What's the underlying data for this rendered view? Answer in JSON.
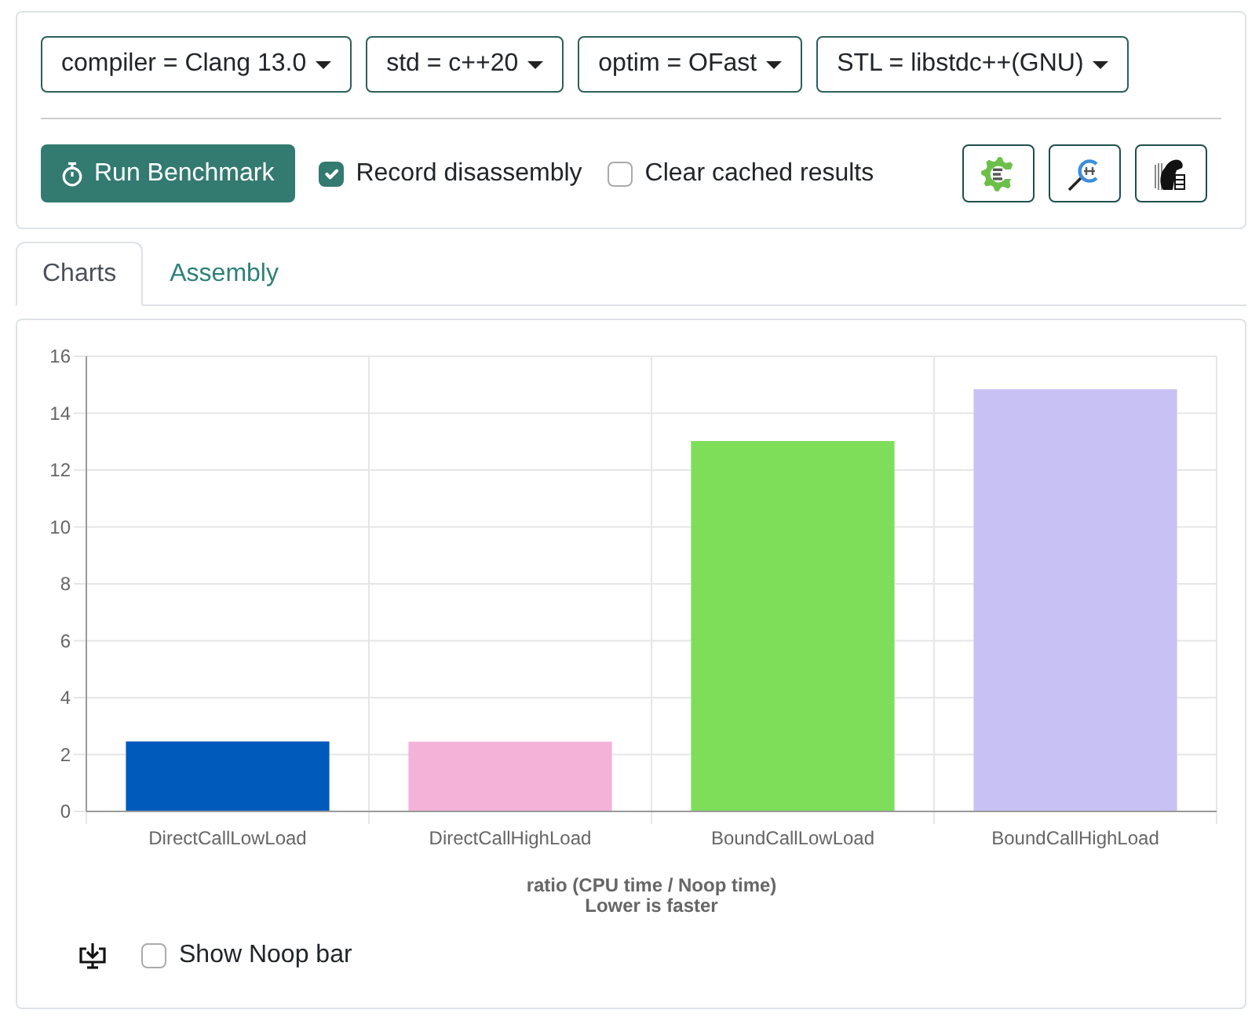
{
  "toolbar": {
    "dropdowns": [
      {
        "label": "compiler = Clang 13.0"
      },
      {
        "label": "std = c++20"
      },
      {
        "label": "optim = OFast"
      },
      {
        "label": "STL = libstdc++(GNU)"
      }
    ],
    "run_button": {
      "label": "Run Benchmark"
    },
    "options": [
      {
        "label": "Record disassembly",
        "checked": true
      },
      {
        "label": "Clear cached results",
        "checked": false
      }
    ]
  },
  "tabs": [
    {
      "label": "Charts",
      "selected": true
    },
    {
      "label": "Assembly",
      "selected": false
    }
  ],
  "chart": {
    "chart_data": {
      "type": "bar",
      "categories": [
        "DirectCallLowLoad",
        "DirectCallHighLoad",
        "BoundCallLowLoad",
        "BoundCallHighLoad"
      ],
      "series": [
        {
          "colors": [
            "#005abb",
            "#f4b2d9",
            "#7ede5a",
            "#c8c1f3"
          ],
          "values": [
            2.46,
            2.45,
            13.02,
            14.84
          ]
        }
      ],
      "xlabel": [
        "ratio (CPU time / Noop time)",
        "Lower is faster"
      ],
      "ylim": [
        0,
        16
      ],
      "yticks": [
        0,
        2,
        4,
        6,
        8,
        10,
        12,
        14,
        16
      ],
      "grid": true
    },
    "options": [
      {
        "label": "Show Noop bar",
        "checked": false
      }
    ]
  }
}
